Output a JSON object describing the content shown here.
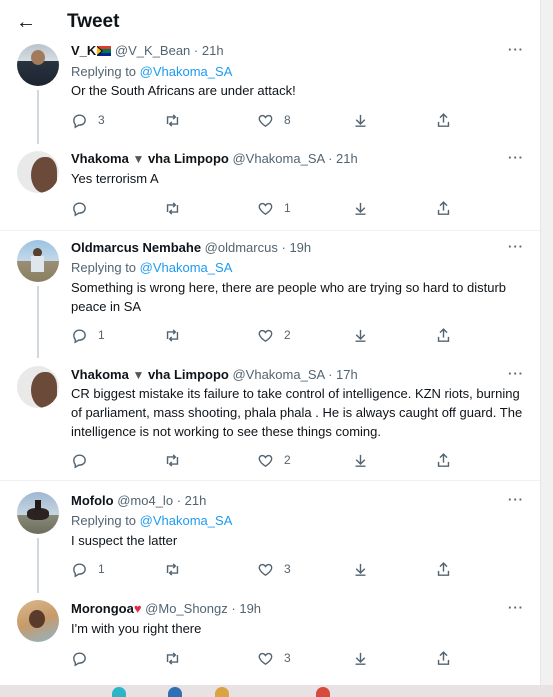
{
  "header": {
    "back_icon": "arrow-left-icon",
    "title": "Tweet"
  },
  "tweets": [
    {
      "name": "V_K",
      "flag": "south-africa-flag-emoji",
      "handle": "@V_K_Bean",
      "time": "21h",
      "replying_prefix": "Replying to",
      "replying_handle": "@Vhakoma_SA",
      "text": "Or the South Africans are under attack!",
      "replies": "3",
      "retweets": "",
      "likes": "8"
    },
    {
      "name": "Vhakoma",
      "emoji": "bat-emoji",
      "name_suffix": "vha Limpopo",
      "handle": "@Vhakoma_SA",
      "time": "21h",
      "text": "Yes terrorism A",
      "replies": "",
      "retweets": "",
      "likes": "1"
    },
    {
      "name": "Oldmarcus Nembahe",
      "handle": "@oldmarcus",
      "time": "19h",
      "replying_prefix": "Replying to",
      "replying_handle": "@Vhakoma_SA",
      "text": "Something is wrong here, there are people who are trying so hard to disturb peace in SA",
      "replies": "1",
      "retweets": "",
      "likes": "2"
    },
    {
      "name": "Vhakoma",
      "emoji": "bat-emoji",
      "name_suffix": "vha Limpopo",
      "handle": "@Vhakoma_SA",
      "time": "17h",
      "text": "CR biggest mistake its failure to take control of intelligence. KZN riots, burning of parliament,  mass shooting, phala phala  . He is always caught off guard.  The intelligence is not working to see these things coming.",
      "replies": "",
      "retweets": "",
      "likes": "2"
    },
    {
      "name": "Mofolo",
      "handle": "@mo4_lo",
      "time": "21h",
      "replying_prefix": "Replying to",
      "replying_handle": "@Vhakoma_SA",
      "text": "I suspect the latter",
      "replies": "1",
      "retweets": "",
      "likes": "3"
    },
    {
      "name": "Morongoa",
      "emoji": "red-heart-emoji",
      "handle": "@Mo_Shongz",
      "time": "19h",
      "text": "I'm with you right there",
      "replies": "",
      "retweets": "",
      "likes": "3"
    }
  ],
  "colors": {
    "accent": "#1d9bf0",
    "secondary_text": "#536471",
    "thread_line": "#cfd9de",
    "heart": "#e0245e"
  }
}
